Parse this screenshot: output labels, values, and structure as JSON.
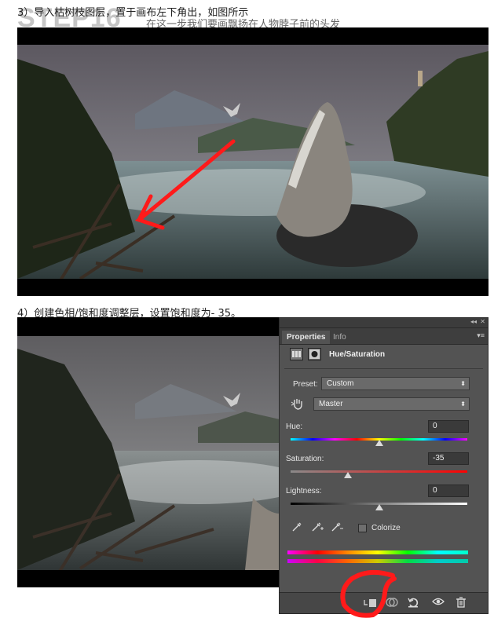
{
  "captions": {
    "step3": "3）导入枯树枝图层，置于画布左下角出，如图所示",
    "step_title": "STEP16",
    "overlay": "在这一步我们要画飘扬在人物脖子前的头发",
    "step4": "4）创建色相/饱和度调整层，设置饱和度为- 35。"
  },
  "panel": {
    "tabs": [
      "Properties",
      "Info"
    ],
    "adjustment_title": "Hue/Saturation",
    "preset_label": "Preset:",
    "preset_value": "Custom",
    "channel_value": "Master",
    "hue_label": "Hue:",
    "hue_value": "0",
    "hue_level": 0,
    "saturation_label": "Saturation:",
    "saturation_value": "-35",
    "saturation_level": -35,
    "lightness_label": "Lightness:",
    "lightness_value": "0",
    "lightness_level": 0,
    "colorize_label": "Colorize"
  },
  "colors": {
    "annotation_red": "#ff1a1a",
    "panel_bg": "#535353"
  },
  "icons": [
    "collapse-double-arrow-icon",
    "close-icon",
    "panel-menu-icon",
    "adjustment-icon",
    "mask-icon",
    "hand-tool-icon",
    "eyedropper-icon",
    "eyedropper-plus-icon",
    "eyedropper-minus-icon",
    "clip-layer-icon",
    "view-previous-icon",
    "reset-icon",
    "visibility-eye-icon",
    "trash-icon"
  ]
}
